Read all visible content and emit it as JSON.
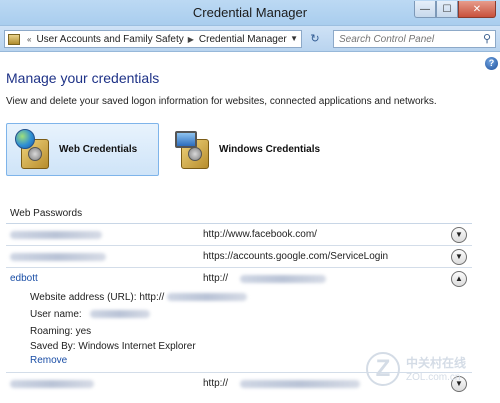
{
  "window": {
    "title": "Credential Manager",
    "min": "—",
    "max": "☐",
    "close": "✕"
  },
  "address": {
    "crumbs": [
      "User Accounts and Family Safety",
      "Credential Manager"
    ],
    "search_placeholder": "Search Control Panel"
  },
  "page": {
    "heading": "Manage your credentials",
    "subtitle": "View and delete your saved logon information for websites, connected applications and networks."
  },
  "tabs": [
    {
      "label": "Web Credentials",
      "selected": true
    },
    {
      "label": "Windows Credentials",
      "selected": false
    }
  ],
  "section": {
    "title": "Web Passwords"
  },
  "entries": [
    {
      "user": "",
      "url": "http://www.facebook.com/",
      "expanded": false
    },
    {
      "user": "",
      "url": "https://accounts.google.com/ServiceLogin",
      "expanded": false
    },
    {
      "user": "edbott",
      "url": "http://",
      "expanded": true
    },
    {
      "user": "",
      "url": "http://",
      "expanded": false
    }
  ],
  "details": {
    "address_label": "Website address (URL):",
    "address_value": "http://",
    "username_label": "User name:",
    "roaming_label": "Roaming:",
    "roaming_value": "yes",
    "savedby_label": "Saved By:",
    "savedby_value": "Windows Internet Explorer",
    "remove_label": "Remove"
  },
  "watermark": {
    "logo": "Z",
    "text": "中关村在线",
    "sub": "ZOL.com.cn"
  },
  "colors": {
    "heading": "#1e3287",
    "link": "#1a4ea6",
    "selected_tab_border": "#7eb4ea"
  }
}
